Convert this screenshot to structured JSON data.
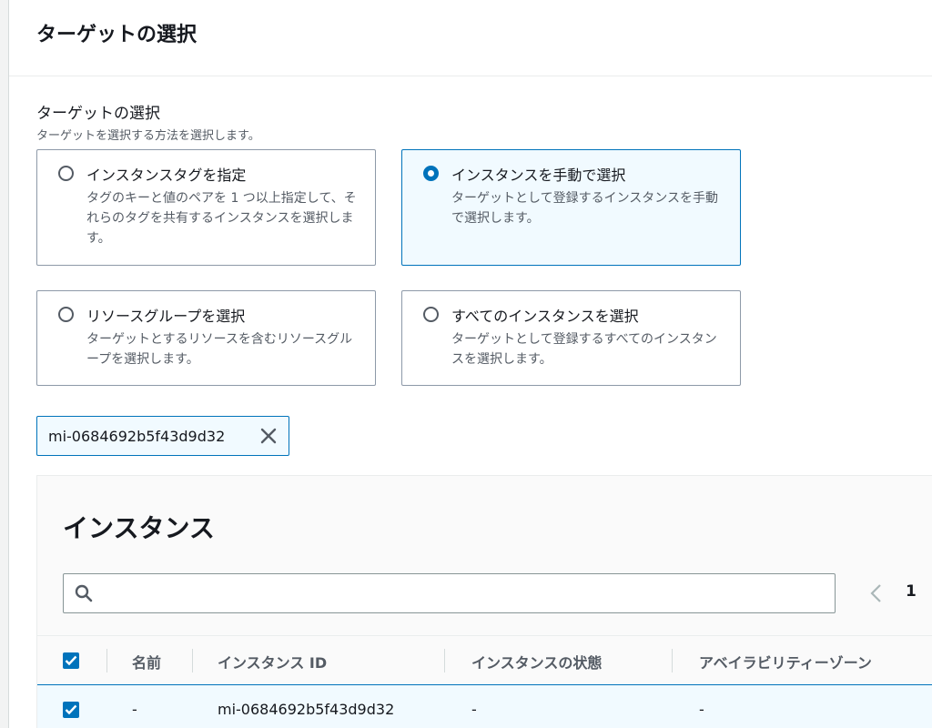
{
  "panel": {
    "title": "ターゲットの選択"
  },
  "field": {
    "label": "ターゲットの選択",
    "description": "ターゲットを選択する方法を選択します。"
  },
  "options": [
    {
      "title": "インスタンスタグを指定",
      "description": "タグのキーと値のペアを 1 つ以上指定して、それらのタグを共有するインスタンスを選択します。",
      "selected": false
    },
    {
      "title": "インスタンスを手動で選択",
      "description": "ターゲットとして登録するインスタンスを手動で選択します。",
      "selected": true
    },
    {
      "title": "リソースグループを選択",
      "description": "ターゲットとするリソースを含むリソースグループを選択します。",
      "selected": false
    },
    {
      "title": "すべてのインスタンスを選択",
      "description": "ターゲットとして登録するすべてのインスタンスを選択します。",
      "selected": false
    }
  ],
  "token": {
    "label": "mi-0684692b5f43d9d32"
  },
  "instances": {
    "title": "インスタンス",
    "search_placeholder": "",
    "page": "1",
    "columns": [
      "名前",
      "インスタンス ID",
      "インスタンスの状態",
      "アベイラビリティーゾーン"
    ],
    "rows": [
      {
        "name": "-",
        "id": "mi-0684692b5f43d9d32",
        "state": "-",
        "az": "-",
        "checked": true
      }
    ],
    "select_all_checked": true
  },
  "colors": {
    "accent": "#0073bb",
    "selected_bg": "#f1faff",
    "text": "#16191f",
    "muted": "#545b64"
  }
}
